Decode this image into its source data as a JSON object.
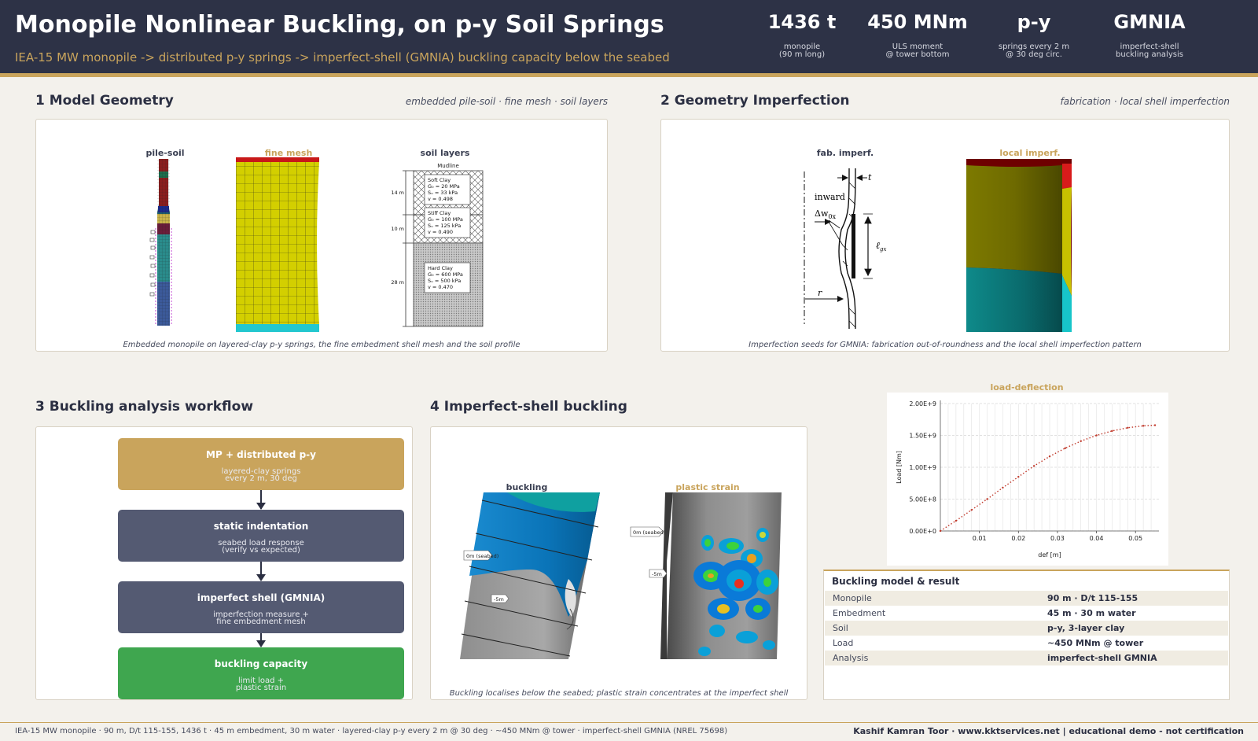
{
  "header": {
    "title": "Monopile Nonlinear Buckling, on p-y Soil Springs",
    "subtitle": "IEA-15 MW monopile -> distributed p-y springs -> imperfect-shell (GMNIA) buckling capacity below the seabed",
    "stats": [
      {
        "value": "1436 t",
        "label": "monopile\n(90 m long)"
      },
      {
        "value": "450 MNm",
        "label": "ULS moment\n@ tower bottom"
      },
      {
        "value": "p-y",
        "label": "springs every 2 m\n@ 30 deg circ."
      },
      {
        "value": "GMNIA",
        "label": "imperfect-shell\nbuckling analysis"
      }
    ]
  },
  "section1": {
    "title": "1  Model Geometry",
    "tags": "embedded pile-soil  ·  fine mesh  ·  soil layers",
    "labels": {
      "pile_soil": "pile-soil",
      "fine_mesh": "fine mesh",
      "soil_layers": "soil layers"
    },
    "soil": {
      "mudline": "Mudline",
      "layers": [
        {
          "depth": "14 m",
          "lines": [
            "Soft Clay",
            "G₀ = 20 MPa",
            "Sᵤ = 33 kPa",
            "v = 0.498"
          ]
        },
        {
          "depth": "10 m",
          "lines": [
            "Stiff Clay",
            "G₀ = 100 MPa",
            "Sᵤ = 125 kPa",
            "v = 0.490"
          ]
        },
        {
          "depth": "28 m",
          "lines": [
            "Hard Clay",
            "G₀ = 600 MPa",
            "Sᵤ = 500 kPa",
            "v = 0.470"
          ]
        }
      ]
    },
    "caption": "Embedded monopile on layered-clay p-y springs, the fine embedment shell mesh and the soil profile"
  },
  "section2": {
    "title": "2  Geometry Imperfection",
    "tags": "fabrication  ·  local shell imperfection",
    "labels": {
      "fab": "fab. imperf.",
      "local": "local imperf."
    },
    "sketch": {
      "inward": "inward",
      "delta": "Δw",
      "delta_sub": "0x",
      "t": "t",
      "r": "r",
      "l": "ℓ",
      "l_sub": "gx"
    },
    "caption": "Imperfection seeds for GMNIA: fabrication out-of-roundness and the local shell imperfection pattern"
  },
  "section3": {
    "title": "3  Buckling analysis workflow",
    "steps": [
      {
        "title": "MP + distributed p-y",
        "sub": "layered-clay springs\nevery 2 m, 30 deg",
        "color": "#c9a45c"
      },
      {
        "title": "static indentation",
        "sub": "seabed load response\n(verify vs expected)",
        "color": "#545a72"
      },
      {
        "title": "imperfect shell (GMNIA)",
        "sub": "imperfection measure +\nfine embedment mesh",
        "color": "#545a72"
      },
      {
        "title": "buckling capacity",
        "sub": "limit load +\nplastic strain",
        "color": "#3fa64f"
      }
    ]
  },
  "section4": {
    "title": "4  Imperfect-shell buckling",
    "labels": {
      "buckling": "buckling",
      "plastic": "plastic strain"
    },
    "tags": {
      "seabed": "0m (seabed)",
      "minus5": "-5m"
    },
    "caption": "Buckling localises below the seabed; plastic strain concentrates at the imperfect shell"
  },
  "chart_data": {
    "type": "line",
    "title": "load-deflection",
    "xlabel": "def [m]",
    "ylabel": "Load [Nm]",
    "xlim": [
      0,
      0.056
    ],
    "ylim": [
      0,
      2000000000.0
    ],
    "x_ticks": [
      0.01,
      0.02,
      0.03,
      0.04,
      0.05
    ],
    "x_tick_labels": [
      "0.01",
      "0.02",
      "0.03",
      "0.04",
      "0.05"
    ],
    "y_ticks": [
      0,
      500000000.0,
      1000000000.0,
      1500000000.0,
      2000000000.0
    ],
    "y_tick_labels": [
      "0.00E+0",
      "5.00E+8",
      "1.00E+9",
      "1.50E+9",
      "2.00E+9"
    ],
    "grid": true,
    "series": [
      {
        "color": "#c0392b",
        "x": [
          0.0,
          0.004,
          0.008,
          0.012,
          0.016,
          0.02,
          0.024,
          0.028,
          0.032,
          0.036,
          0.04,
          0.044,
          0.048,
          0.052,
          0.055
        ],
        "y": [
          0.0,
          160000000.0,
          330000000.0,
          500000000.0,
          680000000.0,
          850000000.0,
          1020000000.0,
          1170000000.0,
          1300000000.0,
          1410000000.0,
          1500000000.0,
          1570000000.0,
          1620000000.0,
          1650000000.0,
          1660000000.0
        ]
      }
    ]
  },
  "table": {
    "title": "Buckling model & result",
    "rows": [
      {
        "k": "Monopile",
        "v": "90 m · D/t 115-155"
      },
      {
        "k": "Embedment",
        "v": "45 m · 30 m water"
      },
      {
        "k": "Soil",
        "v": "p-y, 3-layer clay"
      },
      {
        "k": "Load",
        "v": "~450 MNm @ tower"
      },
      {
        "k": "Analysis",
        "v": "imperfect-shell GMNIA"
      }
    ]
  },
  "footer": {
    "left": "IEA-15 MW monopile  ·  90 m, D/t 115-155, 1436 t  ·  45 m embedment, 30 m water  ·  layered-clay p-y every 2 m @ 30 deg  ·  ~450 MNm @ tower  ·  imperfect-shell GMNIA (NREL 75698)",
    "right": "Kashif Kamran Toor  ·  www.kktservices.net   |   educational demo - not certification"
  }
}
